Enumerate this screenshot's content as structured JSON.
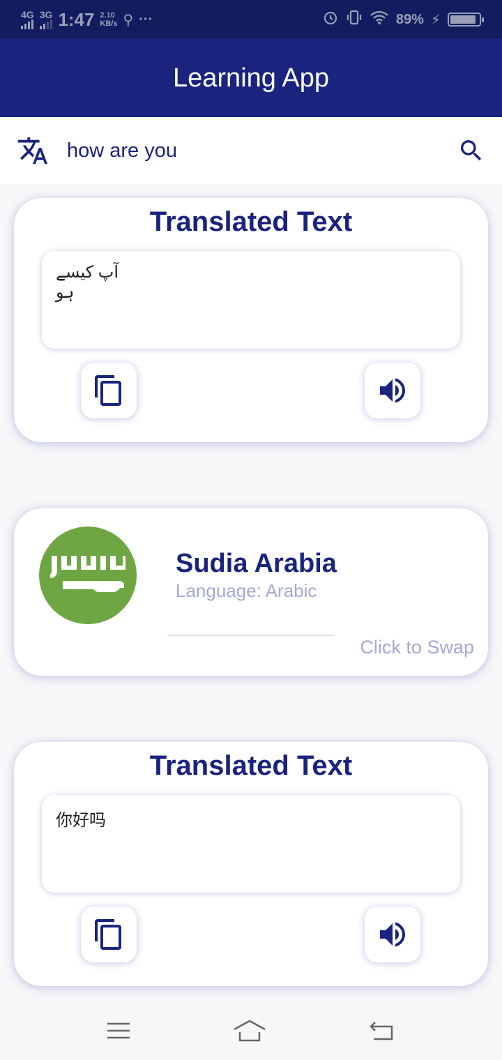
{
  "status_bar": {
    "net1": "4G",
    "net2": "3G",
    "time": "1:47",
    "speed_value": "2.10",
    "speed_unit": "KB/s",
    "more": "···",
    "battery_percent": "89%",
    "battery_level": 0.89
  },
  "app_bar": {
    "title": "Learning App"
  },
  "search": {
    "query": "how are you",
    "translate_icon": "translate-icon",
    "search_icon": "search-icon"
  },
  "cards": [
    {
      "title": "Translated Text",
      "text": "آپ کیسے ہو",
      "direction": "rtl"
    },
    {
      "title": "Translated Text",
      "text": "你好吗",
      "direction": "ltr"
    }
  ],
  "country_card": {
    "country": "Sudia Arabia",
    "language": "Language: Arabic",
    "swap_label": "Click to Swap",
    "flag_color": "#6ea644"
  },
  "colors": {
    "primary": "#1a237e",
    "status_bar": "#131c5e",
    "accent_light": "#a3a8d6",
    "background": "#f7f7f9"
  },
  "nav_bar": {
    "icons": [
      "menu-icon",
      "home-icon",
      "back-icon"
    ]
  }
}
